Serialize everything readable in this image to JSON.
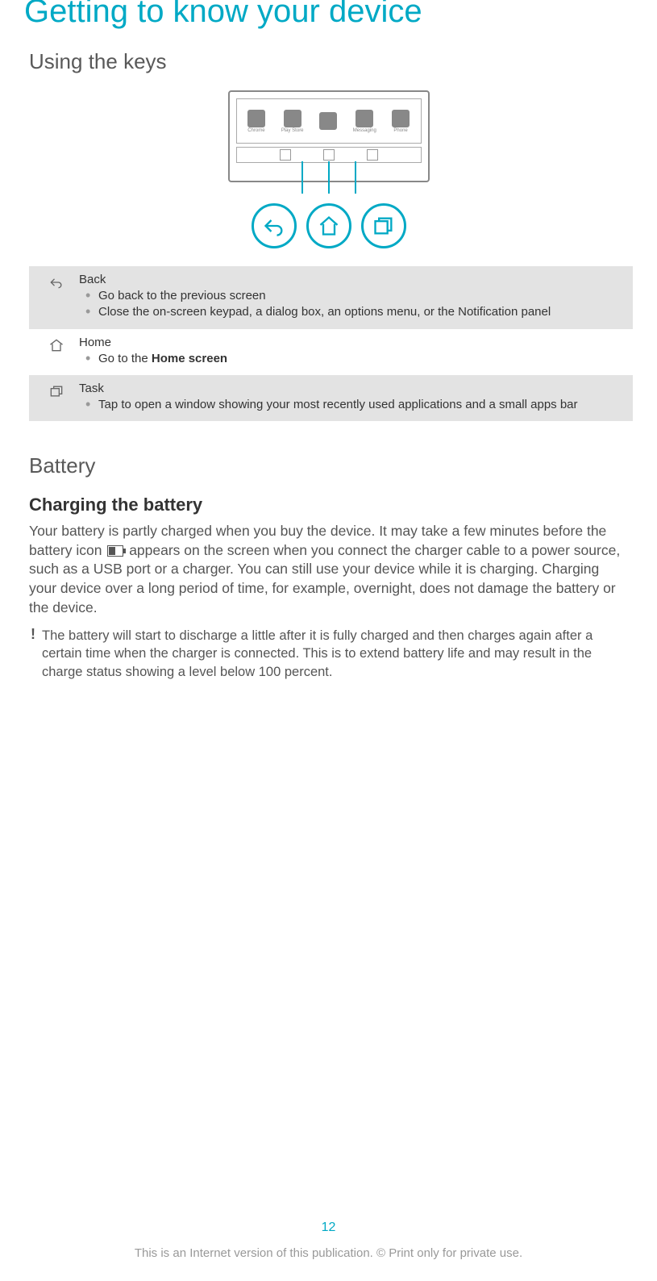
{
  "title": "Getting to know your device",
  "section1": {
    "heading": "Using the keys",
    "illustration": {
      "apps": [
        {
          "label": "Chrome"
        },
        {
          "label": "Play Store"
        },
        {
          "label": ""
        },
        {
          "label": "Messaging"
        },
        {
          "label": "Phone"
        }
      ]
    },
    "rows": [
      {
        "icon": "back",
        "title": "Back",
        "bullets": [
          {
            "text": "Go back to the previous screen"
          },
          {
            "text": "Close the on-screen keypad, a dialog box, an options menu, or the Notification panel"
          }
        ]
      },
      {
        "icon": "home",
        "title": "Home",
        "bullets": [
          {
            "prefix": "Go to the ",
            "bold": "Home screen"
          }
        ]
      },
      {
        "icon": "task",
        "title": "Task",
        "bullets": [
          {
            "text": "Tap to open a window showing your most recently used applications and a small apps bar"
          }
        ]
      }
    ]
  },
  "section2": {
    "heading": "Battery",
    "sub": "Charging the battery",
    "para_parts": {
      "p1": "Your battery is partly charged when you buy the device. It may take a few minutes before the battery icon ",
      "p2": " appears on the screen when you connect the charger cable to a power source, such as a USB port or a charger. You can still use your device while it is charging. Charging your device over a long period of time, for example, overnight, does not damage the battery or the device."
    },
    "note": "The battery will start to discharge a little after it is fully charged and then charges again after a certain time when the charger is connected. This is to extend battery life and may result in the charge status showing a level below 100 percent.",
    "note_mark": "!"
  },
  "footer": {
    "page": "12",
    "copyright": "This is an Internet version of this publication. © Print only for private use."
  }
}
